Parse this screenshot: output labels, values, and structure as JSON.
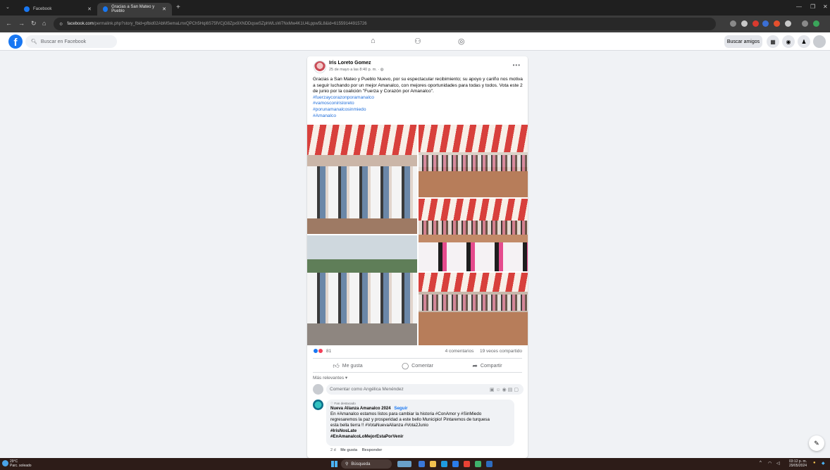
{
  "browser": {
    "tabs": [
      {
        "title": "Facebook",
        "active": false
      },
      {
        "title": "Gracias a San Mateo y Pueblo",
        "active": true
      }
    ],
    "url_domain": "facebook.com",
    "url_path": "/permalink.php?story_fbid=pfbid02AbMSemaLmxQPCh5Hqi6S75fVCjG8Zpx9XNDDqswSZphWLsW7NxMw4K1U4Lppw5L8&id=61559144915726"
  },
  "fb_header": {
    "search_placeholder": "Buscar en Facebook",
    "find_friends": "Buscar amigos"
  },
  "post": {
    "author": "Iris Loreto Gomez",
    "time": "25 de mayo a las 8:40 p. m. · ◍",
    "text": "Gracias a San Mateo y Pueblo Nuevo, por su espectacular recibimiento; su apoyo y cariño nos motiva a seguir luchando por un mejor Amanalco, con mejores oportunidades para todas y todos. Vota este 2 de junio por la coalición \"Fuerza y Corazón por Amanalco\".",
    "hashtags": [
      "#fuerzaycorazonporamanalco",
      "#vamosconirisloreto",
      "#porunamanalcosinmiedo",
      "#Amanalco"
    ],
    "reactions_count": "81",
    "comments_count": "4 comentarios",
    "shares_count": "19 veces compartido",
    "actions": {
      "like": "Me gusta",
      "comment": "Comentar",
      "share": "Compartir"
    },
    "sort_label": "Más relevantes",
    "comment_placeholder": "Comentar como Angélica Menéndez"
  },
  "comment": {
    "badge": "Fan destacado",
    "author": "Nueva Alianza Amanalco 2024",
    "follow": "Seguir",
    "line1": "En #Amanalco estamos listos para cambiar la historia #ConAmor y #SinMiedo",
    "line2": "regresaremos la paz y prosperidad a este bello Municipio! Pintaremos de turquesa",
    "line3": "esta bella tierra !! #VotaNuevaAlianza #Vota2Junio",
    "line4": "#IrisNosLate",
    "line5": "#EnAmanalcoLoMejorEstaPorVenir",
    "age": "2 d",
    "like": "Me gusta",
    "reply": "Responder"
  },
  "taskbar": {
    "temperature": "29°C",
    "weather": "Parc. soleado",
    "search": "Búsqueda",
    "time": "03:12 p. m.",
    "date": "29/05/2024"
  },
  "colors": {
    "facebook_blue": "#1877f2",
    "tent_red": "#d8403c",
    "taskbar": "#2d1c18"
  }
}
